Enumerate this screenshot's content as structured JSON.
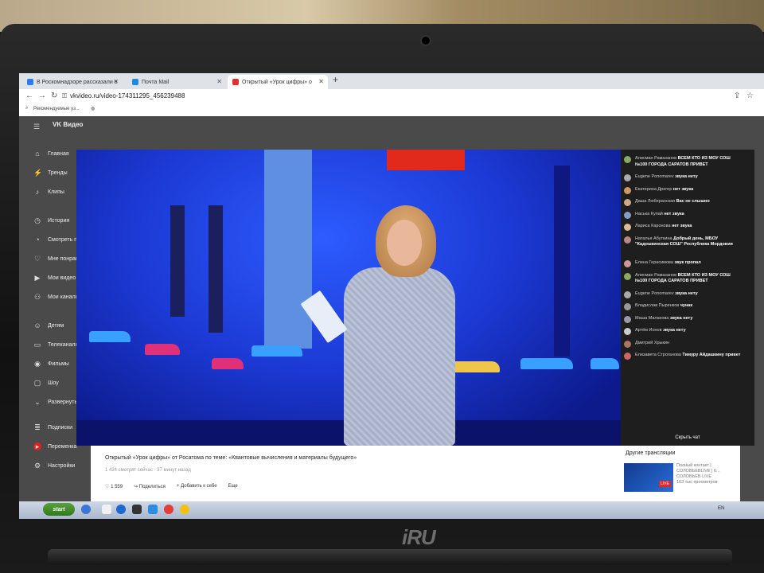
{
  "browser": {
    "tabs": [
      {
        "label": "В Роскомнадзоре рассказали о",
        "color": "#2a7bf4"
      },
      {
        "label": "Почта Mail",
        "color": "#1e88e5"
      },
      {
        "label": "Открытый «Урок цифры» о",
        "color": "#e52d2d",
        "active": true
      }
    ],
    "url": "vkvideo.ru/video-174311295_456239488",
    "bookmark": "Рекомендуемые уз..."
  },
  "sidebar": {
    "logo": "VK Видео",
    "items": [
      "Главная",
      "Тренды",
      "Клипы",
      "История",
      "Смотреть позже",
      "Мне понравилось",
      "Мои видео",
      "Мои каналы",
      "Детям",
      "Телеканалы",
      "Фильмы",
      "Шоу",
      "Развернуть",
      "Подписки",
      "Переменка",
      "Настройки"
    ]
  },
  "chat": {
    "messages": [
      {
        "name": "Алисман Рамазанов",
        "text": "ВСЕМ КТО ИЗ МОУ СОШ №100 ГОРОДА САРАТОВ ПРИВЕТ"
      },
      {
        "name": "Eugene Ponomarev",
        "text": "звука нету"
      },
      {
        "name": "Екатерина Дрегер",
        "text": "нет звука"
      },
      {
        "name": "Даша Люберанская",
        "text": "Вас не слышно"
      },
      {
        "name": "Наська Купай",
        "text": "нет звука"
      },
      {
        "name": "Лариса Каронова",
        "text": "нет звука"
      },
      {
        "name": "Наталья Абуткина",
        "text": "Добрый день, МБОУ \"Кадошкинская СОШ\" Республика Мордовия"
      },
      {
        "name": "Елена Герасимова",
        "text": "звук пропал"
      },
      {
        "name": "Алисман Рамазанов",
        "text": "ВСЕМ КТО ИЗ МОУ СОШ №100 ГОРОДА САРАТОВ ПРИВЕТ"
      },
      {
        "name": "Eugene Ponomarev",
        "text": "звука нету"
      },
      {
        "name": "Владислав Пыренков",
        "text": "чунак"
      },
      {
        "name": "Маша Малахова",
        "text": "звука нету"
      },
      {
        "name": "Артём Ионов",
        "text": "звука нету"
      },
      {
        "name": "Дмитрий Хрыкин",
        "text": ""
      },
      {
        "name": "Елизавета Строганова",
        "text": "Тимуру Айдашкину привет"
      }
    ],
    "hide_label": "Скрыть чат"
  },
  "video": {
    "title": "Открытый «Урок цифры» от Росатома по теме: «Квантовые вычисления и материалы будущего»",
    "meta": "1 424 смотрят сейчас · 37 минут назад",
    "likes": "1 559",
    "share": "Поделиться",
    "add": "Добавить к себе",
    "more": "Еще"
  },
  "other": {
    "heading": "Другие трансляции",
    "item_title": "Полный контакт | СОЛОВЬЕВLIVE | 6...",
    "item_channel": "СОЛОВЬЕВ LIVE",
    "item_views": "163 тыс просмотров",
    "live_badge": "LIVE"
  },
  "taskbar": {
    "start": "start",
    "lang": "EN"
  },
  "monitor": {
    "brand": "iRU"
  }
}
